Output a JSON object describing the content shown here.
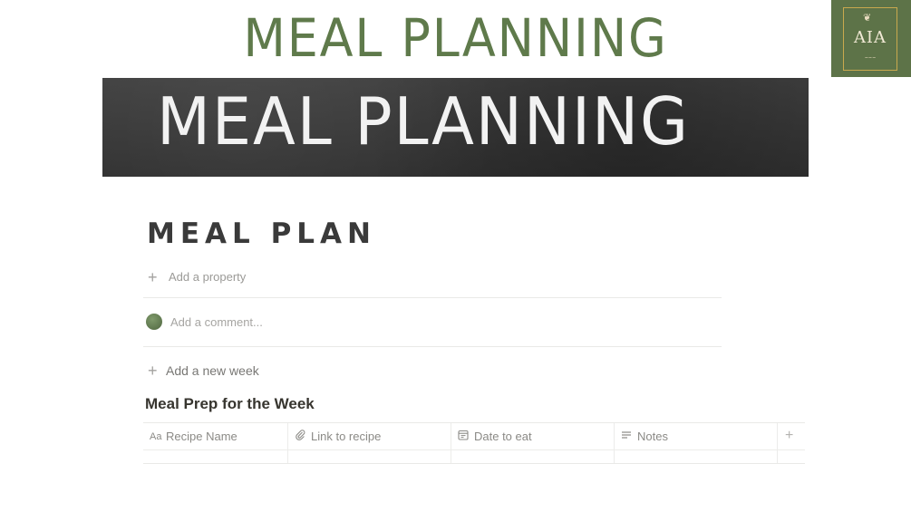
{
  "header": {
    "title": "MEAL PLANNING",
    "logo_text": "AIA"
  },
  "banner": {
    "text": "MEAL PLANNING"
  },
  "page": {
    "heading": "MEAL PLAN",
    "add_property": "Add a property",
    "comment_placeholder": "Add a comment...",
    "add_week": "Add a new week"
  },
  "database": {
    "title": "Meal Prep for the Week",
    "columns": [
      {
        "label": "Recipe Name",
        "icon": "text-property-icon"
      },
      {
        "label": "Link to recipe",
        "icon": "link-icon"
      },
      {
        "label": "Date to eat",
        "icon": "calendar-icon"
      },
      {
        "label": "Notes",
        "icon": "notes-icon"
      }
    ],
    "add_column_icon": "plus-icon"
  },
  "colors": {
    "title_green": "#5f7a4b",
    "logo_bg": "#5d7348",
    "logo_border": "#c9a94e",
    "banner_bg": "#3a3a3a"
  }
}
